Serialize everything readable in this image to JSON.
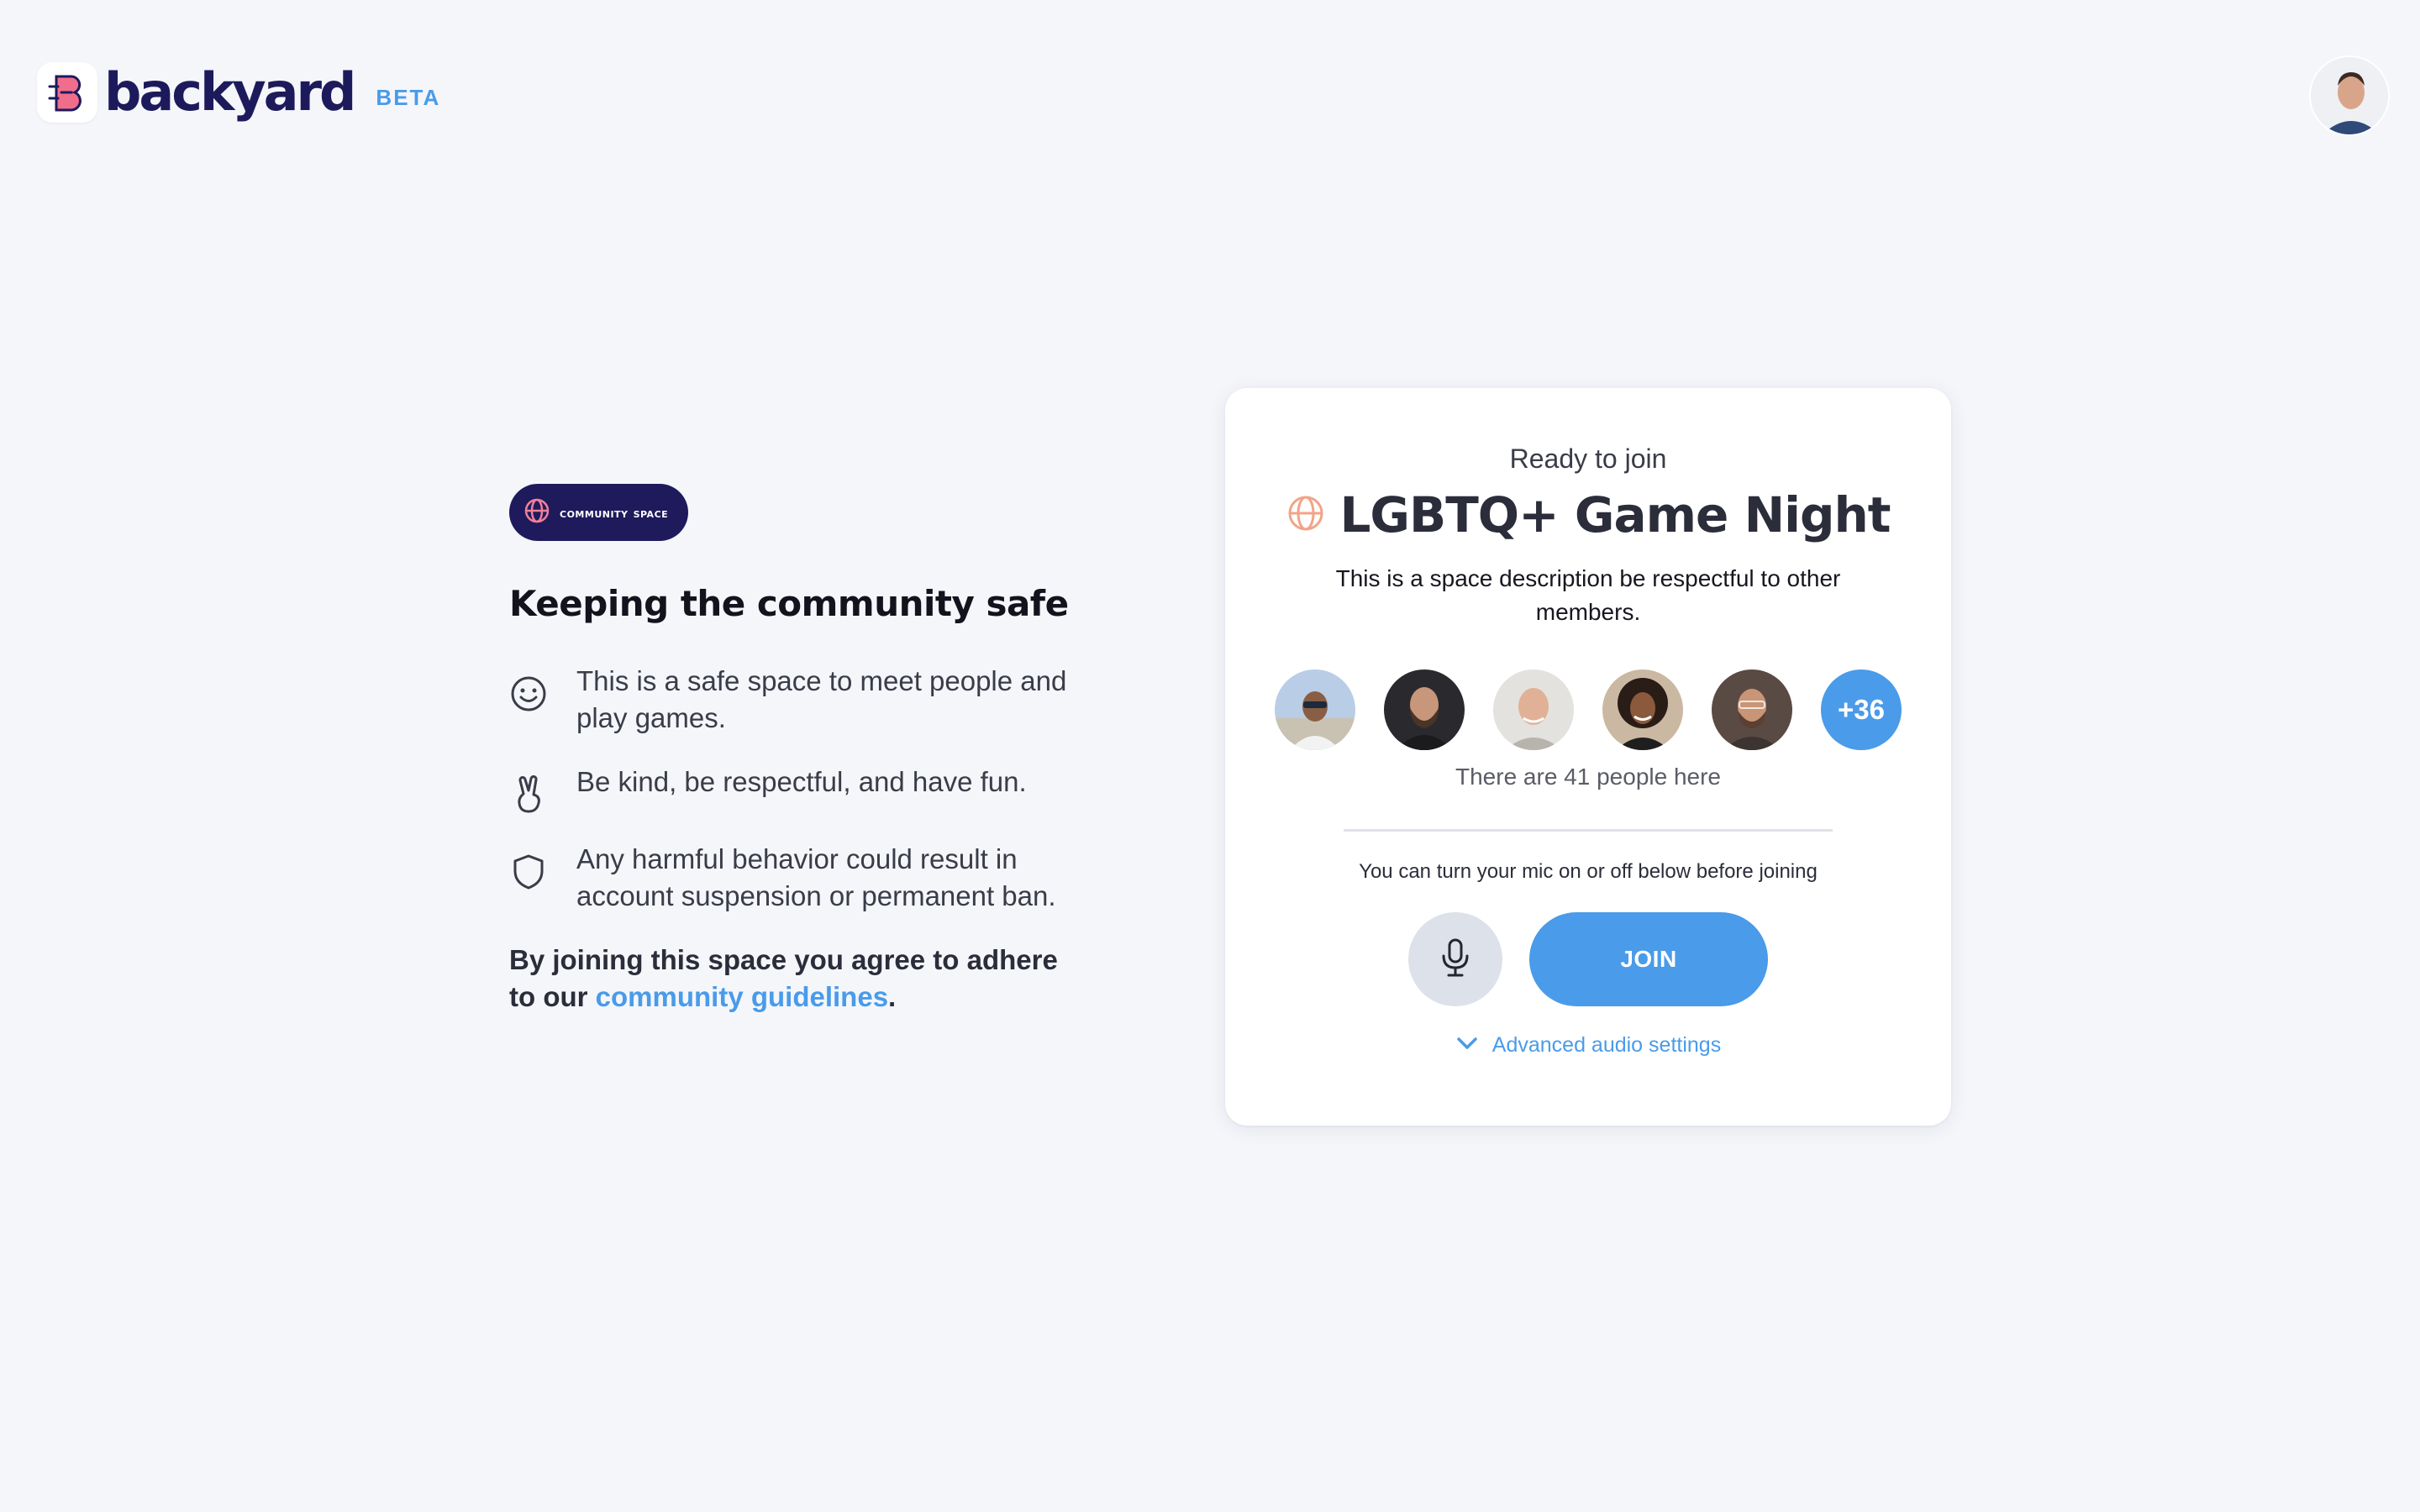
{
  "header": {
    "brand": "backyard",
    "beta_label": "BETA",
    "user_avatar_alt": "user-profile-avatar"
  },
  "left": {
    "badge_label": "community space",
    "title": "Keeping the community safe",
    "rules": [
      {
        "icon": "smiley-icon",
        "text": "This is a safe space to meet people and play games."
      },
      {
        "icon": "peace-hand-icon",
        "text": "Be kind, be respectful, and have fun."
      },
      {
        "icon": "shield-icon",
        "text": "Any harmful behavior could result in account suspension or permanent ban."
      }
    ],
    "agree_prefix": "By joining this space you agree to adhere to our ",
    "agree_link": "community guidelines",
    "agree_suffix": "."
  },
  "card": {
    "ready_label": "Ready to join",
    "space_title": "LGBTQ+ Game Night",
    "space_description": "This is a space description be respectful to other members.",
    "more_count": "+36",
    "people_count_text": "There are 41 people here",
    "mic_hint": "You can turn your mic on or off below before joining",
    "join_label": "JOIN",
    "advanced_label": "Advanced audio settings"
  },
  "colors": {
    "accent": "#4a9be9",
    "brand_navy": "#1e1a5c",
    "background": "#f4f6fa"
  }
}
